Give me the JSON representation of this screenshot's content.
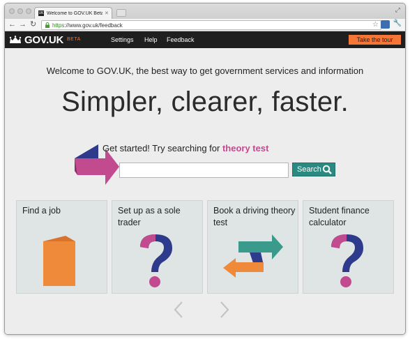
{
  "browser": {
    "tab_title": "Welcome to GOV.UK Beta (Te",
    "tab_favicon": "UK",
    "url_scheme": "https",
    "url_rest": "://www.gov.uk/feedback",
    "icons": [
      "back-arrow-icon",
      "forward-arrow-icon",
      "reload-icon",
      "lock-icon",
      "star-icon",
      "extension-icon",
      "wrench-icon",
      "fullscreen-icon"
    ]
  },
  "govbar": {
    "logo": "GOV.UK",
    "beta": "BETA",
    "nav": [
      "Settings",
      "Help",
      "Feedback"
    ],
    "tour": "Take the tour",
    "accent": "#f47738"
  },
  "main": {
    "welcome": "Welcome to GOV.UK, the best way to get government services and information",
    "headline": "Simpler, clearer, faster.",
    "started_prefix": "Get started! Try searching for ",
    "started_highlight": "theory test",
    "search_value": "",
    "search_button": "Search"
  },
  "cards": [
    {
      "title": "Find a job",
      "icon": "folder-icon"
    },
    {
      "title": "Set up as a sole trader",
      "icon": "question-mark-icon"
    },
    {
      "title": "Book a driving theory test",
      "icon": "two-way-arrows-icon"
    },
    {
      "title": "Student finance calculator",
      "icon": "question-mark-icon"
    }
  ],
  "colors": {
    "dark": "#1f1f1f",
    "magenta": "#c24a8e",
    "teal": "#2a8a82",
    "navy": "#2e3a8c",
    "orange": "#f08a3c"
  }
}
